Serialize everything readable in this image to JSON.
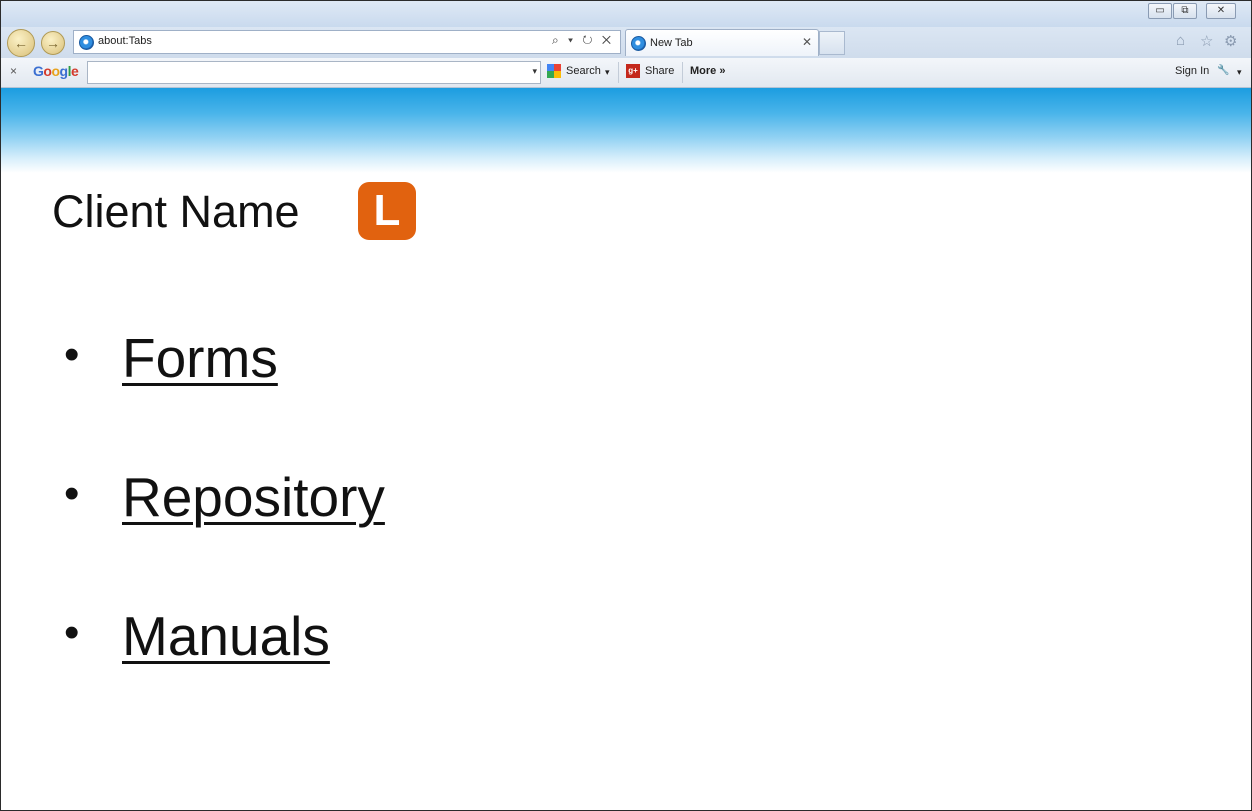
{
  "browser": {
    "address_bar": {
      "url": "about:Tabs",
      "icons": "⌕ ▾ ↻ ✕"
    },
    "tabs": [
      {
        "label": "New Tab",
        "close": "✕"
      }
    ],
    "window_controls": {
      "minimize": "▭",
      "restore": "⧉",
      "close": "✕"
    },
    "nav_icons": [
      "home-icon",
      "favorites-star-icon",
      "tools-gear-icon"
    ]
  },
  "google_toolbar": {
    "close": "×",
    "logo": "Google",
    "search_caret": "▾",
    "search_label": "Search",
    "search_caret2": "▾",
    "share_label": "Share",
    "more_label": "More »",
    "sign_in_label": "Sign In",
    "wrench": "🔧",
    "wrench_caret": "▾"
  },
  "page": {
    "client_name": "Client Name",
    "logo_letter": "L",
    "links": [
      {
        "bullet": "•",
        "label": "Forms"
      },
      {
        "bullet": "•",
        "label": "Repository"
      },
      {
        "bullet": "•",
        "label": "Manuals"
      }
    ]
  },
  "colors": {
    "header_blue": "#1c9de0",
    "logo_orange": "#e1620f"
  }
}
